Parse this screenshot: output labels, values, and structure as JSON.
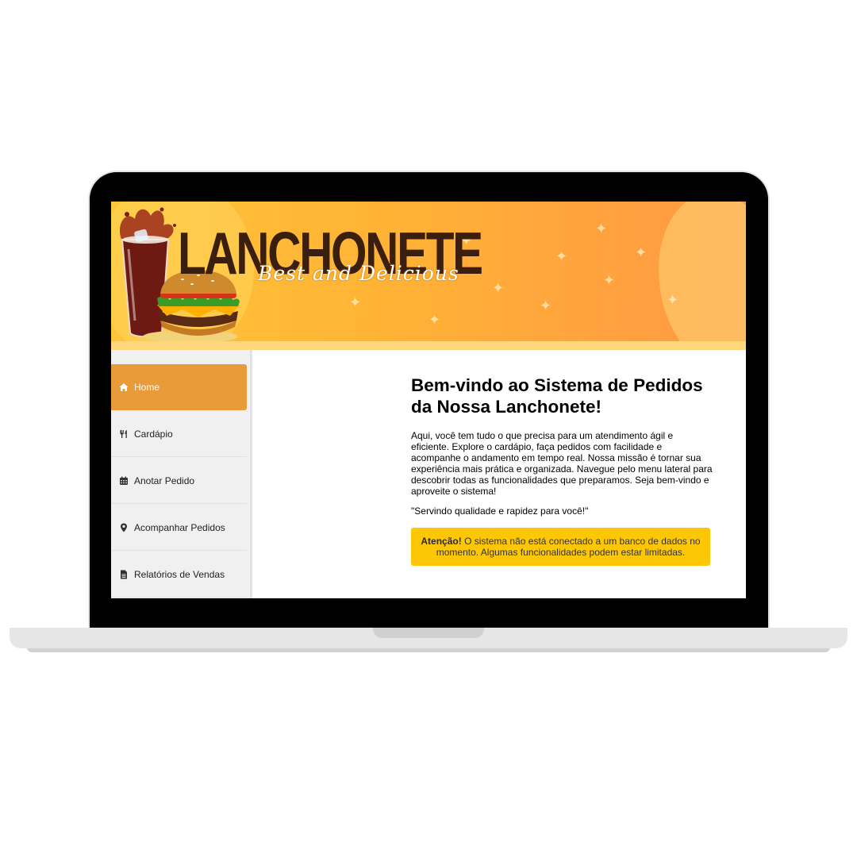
{
  "brand": {
    "title": "LANCHONETE",
    "tagline": "Best and Delicious"
  },
  "sidebar": {
    "items": [
      {
        "label": "Home",
        "icon": "home-icon",
        "active": true
      },
      {
        "label": "Cardápio",
        "icon": "utensils-icon",
        "active": false
      },
      {
        "label": "Anotar Pedido",
        "icon": "calendar-icon",
        "active": false
      },
      {
        "label": "Acompanhar Pedidos",
        "icon": "map-marker-icon",
        "active": false
      },
      {
        "label": "Relatórios de Vendas",
        "icon": "file-icon",
        "active": false
      }
    ]
  },
  "main": {
    "heading": "Bem-vindo ao Sistema de Pedidos da Nossa Lanchonete!",
    "intro": "Aqui, você tem tudo o que precisa para um atendimento ágil e eficiente. Explore o cardápio, faça pedidos com facilidade e acompanhe o andamento em tempo real. Nossa missão é tornar sua experiência mais prática e organizada. Navegue pelo menu lateral para descobrir todas as funcionalidades que preparamos. Seja bem-vindo e aproveite o sistema!",
    "motto": "\"Servindo qualidade e rapidez para você!\"",
    "alert": {
      "title": "Atenção!",
      "message": "O sistema não está conectado a um banco de dados no momento. Algumas funcionalidades podem estar limitadas."
    }
  },
  "colors": {
    "accent": "#e99b3a",
    "alert_bg": "#fdc706",
    "banner_start": "#ffc437",
    "banner_end": "#ff9a44",
    "brand_text": "#3b1f0e"
  }
}
